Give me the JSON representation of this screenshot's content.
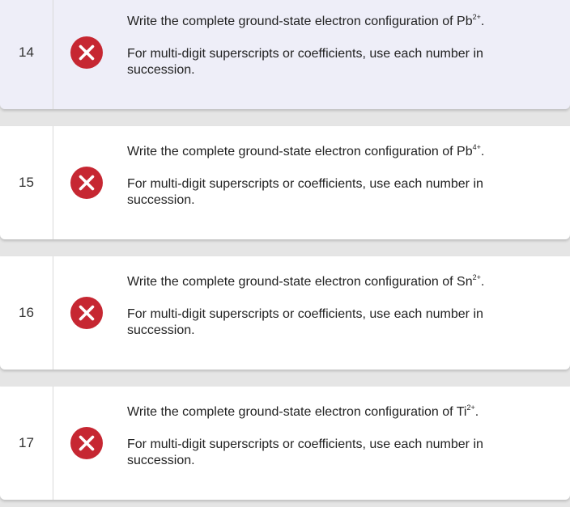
{
  "colors": {
    "incorrect_icon": "#c62732",
    "highlight_row": "#eeeef8",
    "page_background": "#e5e5e5"
  },
  "questions": [
    {
      "number": "14",
      "status_icon": "incorrect-x-icon",
      "prompt_prefix": "Write the complete ground-state electron configuration of Pb",
      "charge": "2+",
      "prompt_suffix": ".",
      "note": "For multi-digit superscripts or coefficients, use each number in succession."
    },
    {
      "number": "15",
      "status_icon": "incorrect-x-icon",
      "prompt_prefix": "Write the complete ground-state electron configuration of Pb",
      "charge": "4+",
      "prompt_suffix": ".",
      "note": "For multi-digit superscripts or coefficients, use each number in succession."
    },
    {
      "number": "16",
      "status_icon": "incorrect-x-icon",
      "prompt_prefix": "Write the complete ground-state electron configuration of Sn",
      "charge": "2+",
      "prompt_suffix": ".",
      "note": "For multi-digit superscripts or coefficients, use each number in succession."
    },
    {
      "number": "17",
      "status_icon": "incorrect-x-icon",
      "prompt_prefix": "Write the complete ground-state electron configuration of Ti",
      "charge": "2+",
      "prompt_suffix": ".",
      "note": "For multi-digit superscripts or coefficients, use each number in succession."
    }
  ]
}
